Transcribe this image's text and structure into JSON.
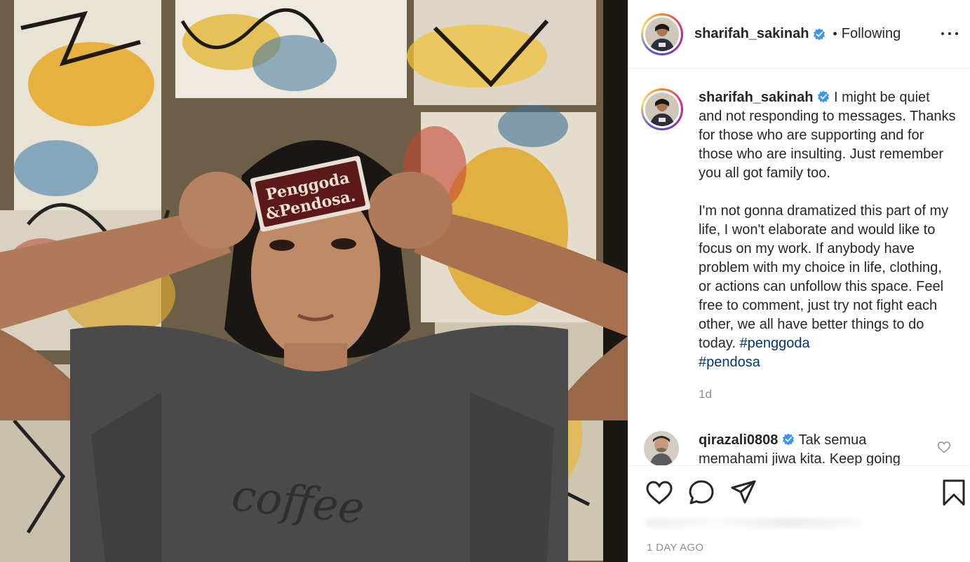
{
  "post": {
    "username": "sharifah_sakinah",
    "follow_status": "Following",
    "separator": "•",
    "image_alt": "Photo of a woman holding a sticker reading Penggoda & Pendosa on her forehead in front of a graffiti wall",
    "sticker_line1": "Penggoda",
    "sticker_line2": "&Pendosa.",
    "shirt_text": "coffee"
  },
  "caption": {
    "username": "sharifah_sakinah",
    "text": " I might be quiet and not responding to messages. Thanks for those who are supporting and for those who are insulting. Just remember you all got family too.\n\nI'm not gonna dramatized this part of my life, I won't elaborate and would like to focus on my work. If anybody have problem with my choice in life, clothing, or actions can unfollow this space. Feel free to comment, just try not fight each other, we all have better things to do today. ",
    "hashtags": [
      "#penggoda",
      "#pendosa"
    ],
    "age": "1d"
  },
  "comment": {
    "username": "qirazali0808",
    "text": " Tak semua memahami jiwa kita. Keep going"
  },
  "footer": {
    "timestamp": "1 DAY AGO"
  },
  "icons": {
    "verified": "verified-badge-icon",
    "more": "more-options-icon",
    "like": "heart-icon",
    "comment": "comment-bubble-icon",
    "share": "paper-plane-icon",
    "save": "bookmark-icon"
  },
  "colors": {
    "verified_blue": "#3897f0",
    "hashtag": "#00376b",
    "muted": "#8e8e8e",
    "text": "#262626"
  }
}
